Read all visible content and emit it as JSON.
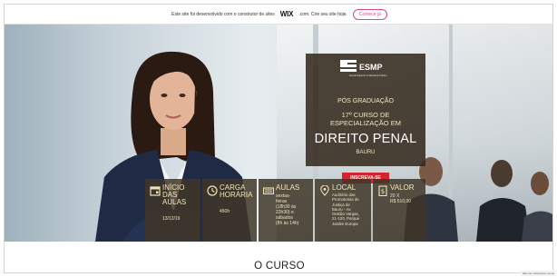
{
  "wix_banner": {
    "message": "Este site foi desenvolvido com o construtor de sites",
    "logo": "WIX",
    "suffix": ".com. Crie seu site hoje.",
    "button_label": "Comece já"
  },
  "esmp_panel": {
    "logo_text": "ESMP",
    "logo_subtitle": "Escola Superior do Ministério Público",
    "pos_graduacao": "PÓS GRADUAÇÃO",
    "curso_line1": "17º CURSO DE",
    "curso_line2": "ESPECIALIZAÇÃO EM",
    "direito_penal": "DIREITO PENAL",
    "cidade": "BAURU"
  },
  "cta": {
    "label": "INSCREVA-SE"
  },
  "info_boxes": {
    "inicio": {
      "title_line1": "INÍCIO",
      "title_line2": "DAS",
      "title_line3": "AULAS",
      "value": "13/12/19",
      "icon": "calendar-icon"
    },
    "carga": {
      "title_line1": "CARGA",
      "title_line2": "HORÁRIA",
      "value": "450h",
      "icon": "clock-icon"
    },
    "aulas": {
      "title": "AULAS",
      "line1": "sextas-",
      "line2": "feiras",
      "line3": "(18h30 às",
      "line4": "22h30) e",
      "line5": "sábados",
      "line6": "(8h às 14h)",
      "icon": "keyboard-icon"
    },
    "local": {
      "title": "LOCAL",
      "line1": "Auditório das",
      "line2": "Promotorias de",
      "line3": "Justiça de",
      "line4": "Bauru - Av.",
      "line5": "Getúlio Vargas,",
      "line6": "21-120, Parque",
      "line7": "Jardim Europa",
      "icon": "map-pin-icon"
    },
    "valor": {
      "title": "VALOR",
      "line1": "20 X",
      "line2": "R$ 510,00",
      "icon": "money-icon"
    }
  },
  "section": {
    "title": "O CURSO"
  },
  "corner_note": "Não há notificações novas"
}
